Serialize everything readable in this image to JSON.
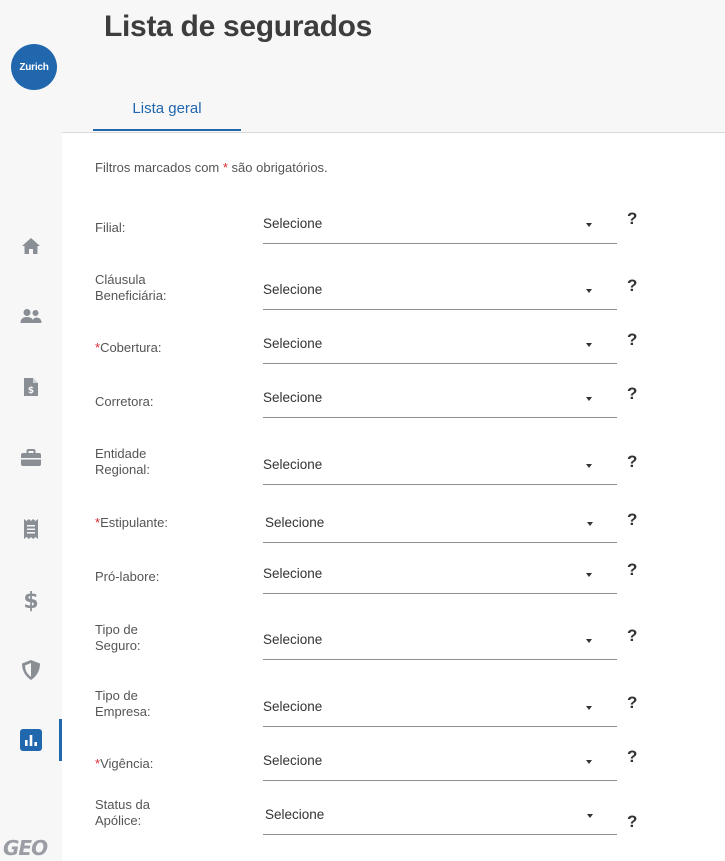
{
  "sidebar": {
    "logo_text": "Zurich",
    "items": [
      {
        "icon": "home-icon"
      },
      {
        "icon": "users-icon"
      },
      {
        "icon": "document-dollar-icon"
      },
      {
        "icon": "briefcase-icon"
      },
      {
        "icon": "receipt-icon"
      },
      {
        "icon": "dollar-icon"
      },
      {
        "icon": "shield-icon"
      },
      {
        "icon": "bar-chart-icon",
        "active": true
      }
    ],
    "footer_logo": "GEO"
  },
  "header": {
    "title": "Lista de segurados",
    "tabs": [
      {
        "label": "Lista geral",
        "active": true
      }
    ]
  },
  "filters": {
    "note_before": "Filtros marcados com ",
    "note_asterisk": "*",
    "note_after": " são obrigatórios.",
    "fields": [
      {
        "label": "Filial:",
        "required": false,
        "value": "Selecione"
      },
      {
        "label": "Cláusula Beneficiária:",
        "required": false,
        "value": "Selecione"
      },
      {
        "label": "Cobertura:",
        "required": true,
        "value": "Selecione"
      },
      {
        "label": "Corretora:",
        "required": false,
        "value": "Selecione"
      },
      {
        "label": "Entidade Regional:",
        "required": false,
        "value": "Selecione"
      },
      {
        "label": "Estipulante:",
        "required": true,
        "value": "Selecione"
      },
      {
        "label": "Pró-labore:",
        "required": false,
        "value": "Selecione"
      },
      {
        "label": "Tipo de Seguro:",
        "required": false,
        "value": "Selecione"
      },
      {
        "label": "Tipo de Empresa:",
        "required": false,
        "value": "Selecione"
      },
      {
        "label": "Vigência:",
        "required": true,
        "value": "Selecione"
      },
      {
        "label": "Status da Apólice:",
        "required": false,
        "value": "Selecione"
      }
    ],
    "help_symbol": "?"
  },
  "colors": {
    "brand": "#2167ae",
    "required": "#d8282f",
    "sidebar_bg": "#f7f7f8",
    "icon": "#8a8f96"
  }
}
